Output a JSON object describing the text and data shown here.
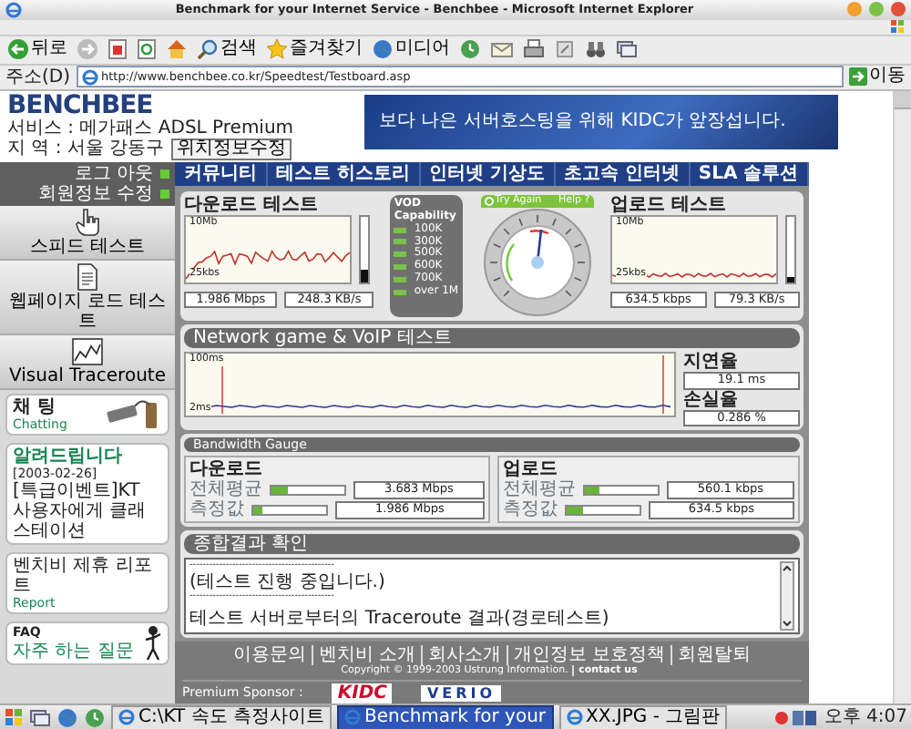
{
  "window": {
    "title": "Benchmark for your Internet Service - Benchbee - Microsoft Internet Explorer"
  },
  "toolbar": [
    {
      "kind": "back",
      "label": "뒤로"
    },
    {
      "kind": "forward"
    },
    {
      "kind": "stop"
    },
    {
      "kind": "refresh"
    },
    {
      "kind": "home"
    },
    {
      "kind": "search",
      "label": "검색"
    },
    {
      "kind": "favorites",
      "label": "즐겨찾기"
    },
    {
      "kind": "media",
      "label": "미디어"
    },
    {
      "kind": "history"
    },
    {
      "kind": "mail"
    },
    {
      "kind": "print"
    },
    {
      "kind": "edit"
    },
    {
      "kind": "binoculars"
    },
    {
      "kind": "windows"
    }
  ],
  "address_bar": {
    "label": "주소(D)",
    "url": "http://www.benchbee.co.kr/Speedtest/Testboard.asp",
    "go": "이동"
  },
  "site": {
    "logo": "BENCHBEE",
    "service": "서비스 : 메가패스 ADSL Premium",
    "region": "지 역 : 서울 강동구",
    "edit_location": "위치정보수정",
    "banner": "보다 나은 서버호스팅을 위해 KIDC가 앞장섭니다."
  },
  "account_links": [
    "로그 아웃",
    "회원정보 수정"
  ],
  "side_nav": [
    {
      "kind": "hand",
      "label": "스피드 테스트"
    },
    {
      "kind": "document",
      "label": "웹페이지 로드 테스트"
    },
    {
      "kind": "chart",
      "label": "Visual Traceroute"
    }
  ],
  "side_boxes": [
    {
      "kind": "chat",
      "title": "채 팅",
      "subtitle": "Chatting"
    },
    {
      "kind": "notice",
      "title": "알려드립니다",
      "date": "[2003-02-26]",
      "text": "[특급이벤트]KT 사용자에게 클래스테이션"
    },
    {
      "kind": "report",
      "title": "벤치비 제휴 리포트",
      "subtitle": "Report"
    },
    {
      "kind": "faq",
      "title": "FAQ",
      "subtitle": "자주 하는 질문"
    }
  ],
  "main_nav": [
    "커뮤니티",
    "테스트 히스토리",
    "인터넷 기상도",
    "초고속 인터넷",
    "SLA 솔루션"
  ],
  "download": {
    "title": "다운로드 테스트",
    "axis_top": "10Mb",
    "axis_bottom": "25kbs",
    "level": 0.2,
    "speed": "1.986 Mbps",
    "rate": "248.3 KB/s"
  },
  "vod": {
    "title": "VOD Capability",
    "levels": [
      "100K",
      "300K",
      "500K",
      "600K",
      "700K",
      "over 1M"
    ]
  },
  "gauge": {
    "try_again": "Try Again",
    "help": "Help",
    "help_mark": "?"
  },
  "upload": {
    "title": "업로드 테스트",
    "axis_top": "10Mb",
    "axis_bottom": "25kbs",
    "level": 0.08,
    "speed": "634.5 kbps",
    "rate": "79.3 KB/s"
  },
  "network": {
    "title": "Network game & VoIP 테스트",
    "axis_top": "100ms",
    "axis_bottom": "2ms",
    "latency_label": "지연율",
    "latency": "19.1 ms",
    "loss_label": "손실율",
    "loss": "0.286 %"
  },
  "bandwidth": {
    "title": "Bandwidth Gauge",
    "groups": [
      {
        "title": "다운로드",
        "rows": [
          {
            "label": "전체평균",
            "level": 0.22,
            "value": "3.683 Mbps"
          },
          {
            "label": "측정값",
            "level": 0.12,
            "value": "1.986 Mbps"
          }
        ]
      },
      {
        "title": "업로드",
        "rows": [
          {
            "label": "전체평균",
            "level": 0.2,
            "value": "560.1 kbps"
          },
          {
            "label": "측정값",
            "level": 0.22,
            "value": "634.5 kbps"
          }
        ]
      }
    ]
  },
  "result": {
    "title": "종합결과 확인",
    "lines": [
      "--------------------------------------------",
      "(테스트 진행 중입니다.)",
      "--------------------------------------------",
      "테스트 서버로부터의 Traceroute 결과(경로테스트)"
    ]
  },
  "footer": {
    "links": [
      "이용문의",
      "벤치비 소개",
      "회사소개",
      "개인정보 보호정책",
      "회원탈퇴"
    ],
    "copyright": "Copyright © 1999-2003 Ustrung Information.",
    "contact": "contact us",
    "sponsor_label": "Premium Sponsor :",
    "sponsors": [
      {
        "kind": "kidc",
        "name": "KIDC"
      },
      {
        "kind": "verio",
        "name": "VERIO"
      }
    ]
  },
  "taskbar": {
    "tasks": [
      {
        "label": "C:\\KT 속도 측정사이트",
        "selected": false
      },
      {
        "label": "Benchmark for your",
        "selected": true
      },
      {
        "label": "XX.JPG - 그림판",
        "selected": false
      }
    ],
    "clock": "오후 4:07"
  }
}
